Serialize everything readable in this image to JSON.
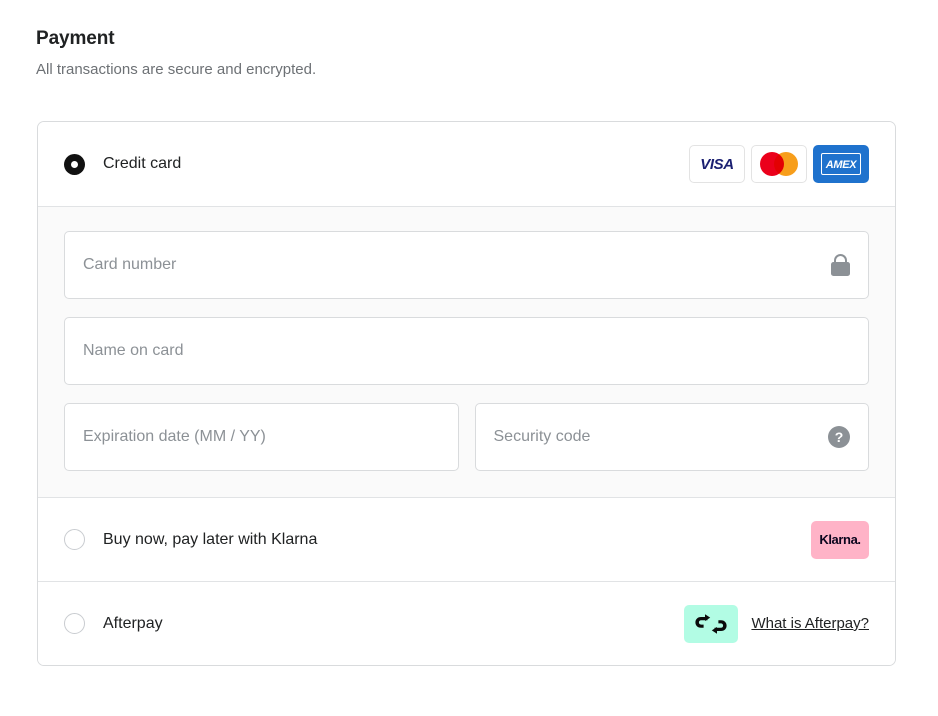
{
  "header": {
    "title": "Payment",
    "subtitle": "All transactions are secure and encrypted."
  },
  "colors": {
    "visa_blue": "#1A1F71",
    "mastercard_red": "#EB001B",
    "mastercard_orange": "#F79E1B",
    "amex_blue": "#1F72CD",
    "klarna_pink": "#FFB3C7",
    "afterpay_mint": "#B2FCE4",
    "card_border": "#D9DBDD",
    "panel_background": "#FAFAFA",
    "placeholder_text": "#8C9196",
    "body_text": "#202223"
  },
  "methods": {
    "credit_card": {
      "label": "Credit card",
      "selected": true,
      "brands": [
        {
          "name": "visa",
          "text": "VISA"
        },
        {
          "name": "mastercard",
          "text": ""
        },
        {
          "name": "amex",
          "text": "AMEX"
        }
      ],
      "fields": {
        "card_number": {
          "placeholder": "Card number",
          "value": "",
          "icon": "lock-icon"
        },
        "name_on_card": {
          "placeholder": "Name on card",
          "value": ""
        },
        "expiration": {
          "placeholder": "Expiration date (MM / YY)",
          "value": ""
        },
        "security_code": {
          "placeholder": "Security code",
          "value": "",
          "icon": "help-icon",
          "icon_glyph": "?"
        }
      }
    },
    "klarna": {
      "label": "Buy now, pay later with Klarna",
      "selected": false,
      "badge_text": "Klarna."
    },
    "afterpay": {
      "label": "Afterpay",
      "selected": false,
      "link_text": "What is Afterpay?"
    }
  }
}
